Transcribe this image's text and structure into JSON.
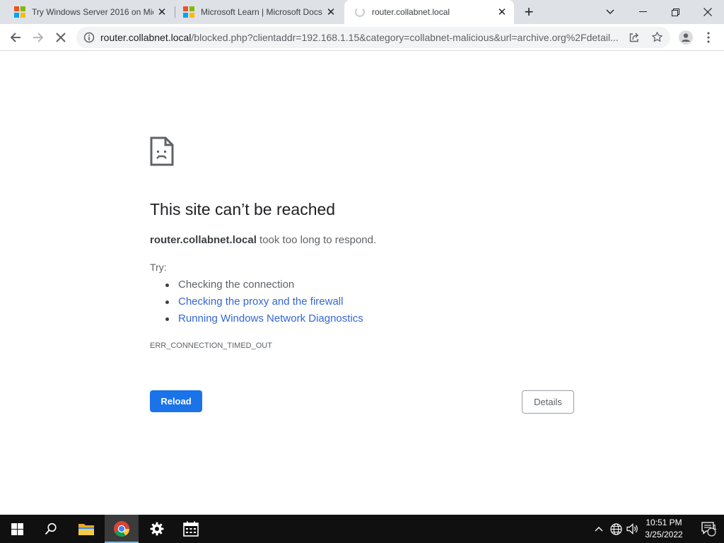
{
  "browser": {
    "tabs": [
      {
        "title": "Try Windows Server 2016 on Mic",
        "close": "✕"
      },
      {
        "title": "Microsoft Learn | Microsoft Docs",
        "close": "✕"
      },
      {
        "title": "router.collabnet.local",
        "close": "✕",
        "active": true
      }
    ],
    "new_tab": "+",
    "address": {
      "host": "router.collabnet.local",
      "rest": "/blocked.php?clientaddr=192.168.1.15&category=collabnet-malicious&url=archive.org%2Fdetail..."
    }
  },
  "page": {
    "title": "This site can’t be reached",
    "host": "router.collabnet.local",
    "description_tail": " took too long to respond.",
    "try_label": "Try:",
    "suggestions": [
      "Checking the connection",
      "Checking the proxy and the firewall",
      "Running Windows Network Diagnostics"
    ],
    "error_code": "ERR_CONNECTION_TIMED_OUT",
    "reload_label": "Reload",
    "details_label": "Details"
  },
  "taskbar": {
    "time": "10:51 PM",
    "date": "3/25/2022",
    "notification_count": "1"
  },
  "colors": {
    "accent": "#1a73e8",
    "link": "#3367d6",
    "tabstrip": "#dee1e6",
    "taskbar": "#101010"
  }
}
